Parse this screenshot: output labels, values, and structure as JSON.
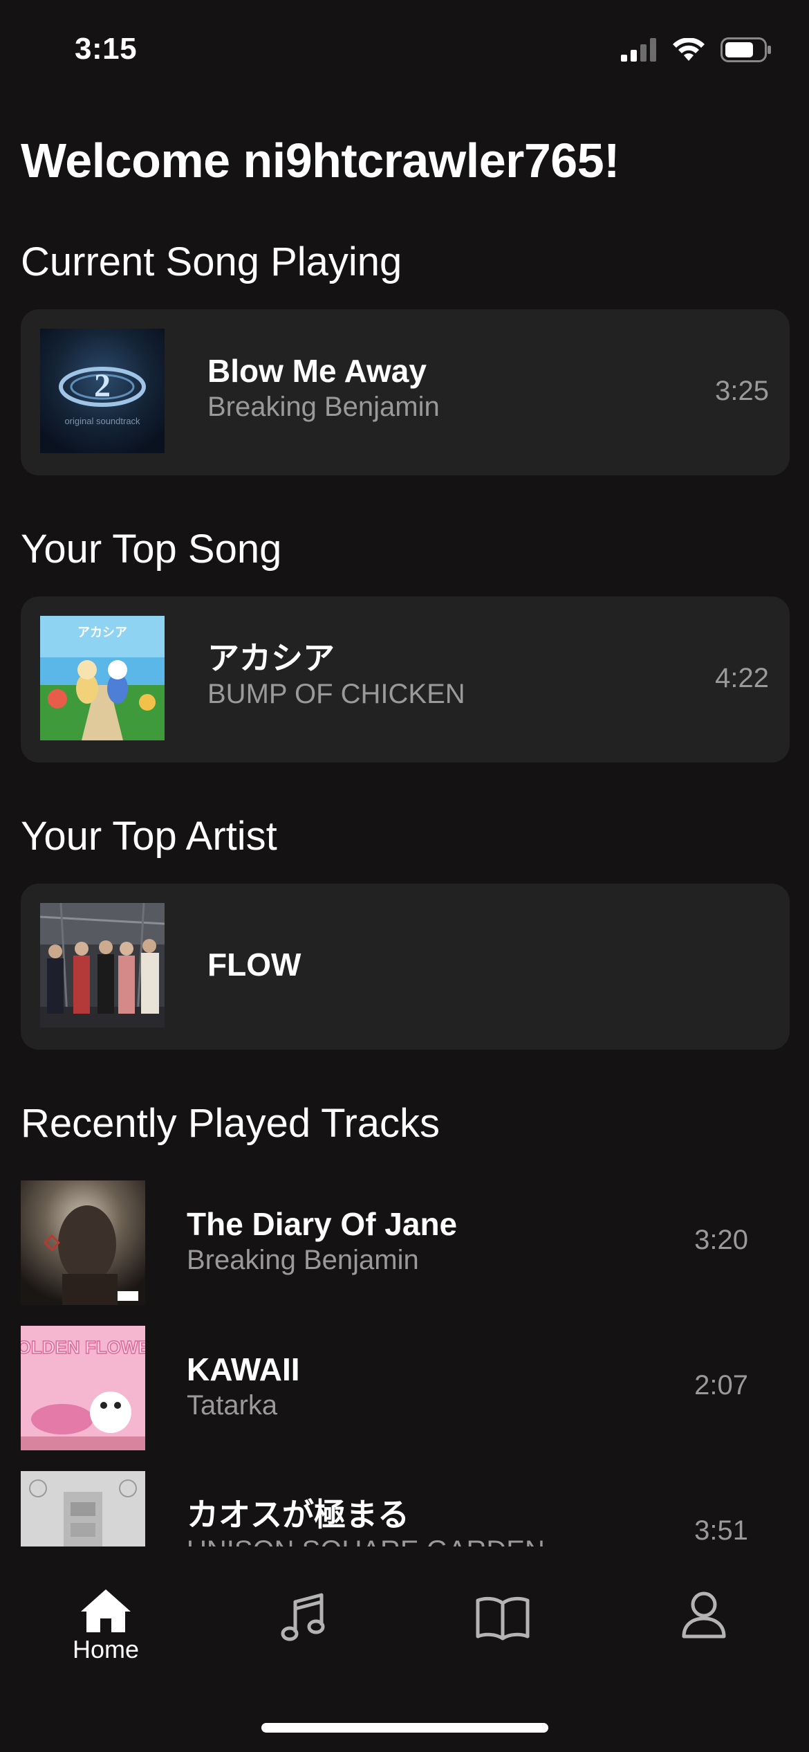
{
  "status_bar": {
    "time": "3:15"
  },
  "welcome": "Welcome ni9htcrawler765!",
  "sections": {
    "current": "Current Song Playing",
    "top_song": "Your Top Song",
    "top_artist": "Your Top Artist",
    "recent": "Recently Played Tracks"
  },
  "current_song": {
    "title": "Blow Me Away",
    "artist": "Breaking Benjamin",
    "duration": "3:25",
    "art_text": "original soundtrack"
  },
  "top_song": {
    "title": "アカシア",
    "artist": "BUMP OF CHICKEN",
    "duration": "4:22"
  },
  "top_artist": {
    "name": "FLOW"
  },
  "recent_tracks": [
    {
      "title": "The Diary Of Jane",
      "artist": "Breaking Benjamin",
      "duration": "3:20"
    },
    {
      "title": "KAWAII",
      "artist": "Tatarka",
      "duration": "2:07",
      "art_text": "GOLDEN FLOWER"
    },
    {
      "title": "カオスが極まる",
      "artist": "UNISON SQUARE GARDEN",
      "duration": "3:51"
    }
  ],
  "tab_bar": {
    "items": [
      {
        "label": "Home",
        "icon": "house-icon",
        "active": true
      },
      {
        "label": "",
        "icon": "music-note-icon",
        "active": false
      },
      {
        "label": "",
        "icon": "book-icon",
        "active": false
      },
      {
        "label": "",
        "icon": "person-icon",
        "active": false
      }
    ]
  },
  "colors": {
    "background": "#141212",
    "card": "#232223",
    "secondary_text": "#9b9a9b",
    "primary_text": "#ffffff"
  }
}
